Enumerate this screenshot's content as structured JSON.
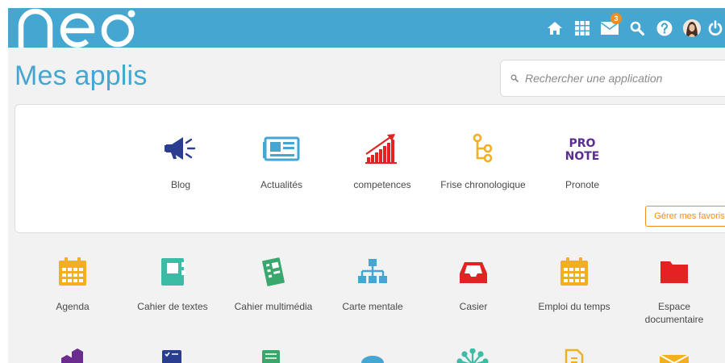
{
  "header": {
    "logo_text": "neo",
    "mail_badge_count": "3"
  },
  "page": {
    "title": "Mes applis"
  },
  "search": {
    "placeholder": "Rechercher une application"
  },
  "favorites": {
    "items": [
      {
        "label": "Blog",
        "icon": "megaphone-icon"
      },
      {
        "label": "Actualités",
        "icon": "newspaper-icon"
      },
      {
        "label": "competences",
        "icon": "bar-chart-icon"
      },
      {
        "label": "Frise chronologique",
        "icon": "timeline-icon"
      },
      {
        "label": "Pronote",
        "icon": "pronote-logo-icon"
      }
    ],
    "manage_label": "Gérer mes favoris"
  },
  "apps": {
    "items": [
      {
        "label": "Agenda",
        "icon": "calendar-icon"
      },
      {
        "label": "Cahier de textes",
        "icon": "notebook-icon"
      },
      {
        "label": "Cahier multimédia",
        "icon": "multimedia-notebook-icon"
      },
      {
        "label": "Carte mentale",
        "icon": "mind-map-icon"
      },
      {
        "label": "Casier",
        "icon": "inbox-tray-icon"
      },
      {
        "label": "Emploi du temps",
        "icon": "schedule-calendar-icon"
      },
      {
        "label": "Espace documentaire",
        "icon": "folder-icon"
      }
    ]
  },
  "colors": {
    "header_bg": "#45a6d1",
    "title": "#45a6d1",
    "accent_orange": "#f38d1d",
    "page_bg": "#f2f2f2"
  }
}
